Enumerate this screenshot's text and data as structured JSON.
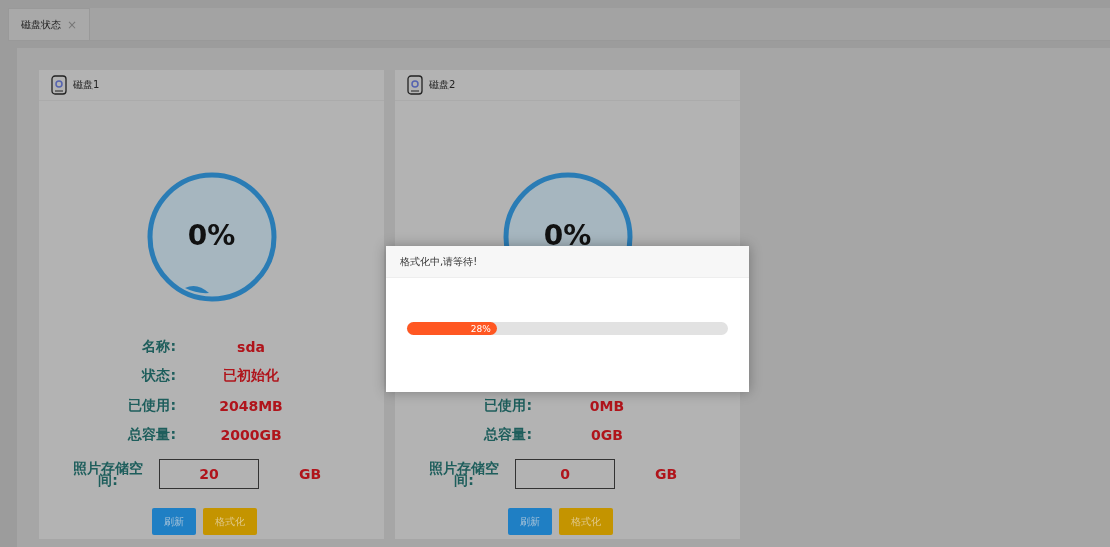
{
  "tabs": [
    {
      "label": "磁盘状态",
      "close": "×",
      "selected": true
    }
  ],
  "disks": [
    {
      "title": "磁盘1",
      "percent": "0%",
      "fields": [
        {
          "label": "名称:",
          "value": "sda"
        },
        {
          "label": "状态:",
          "value": "已初始化"
        },
        {
          "label": "已使用:",
          "value": "2048MB"
        },
        {
          "label": "总容量:",
          "value": "2000GB"
        }
      ],
      "storage": {
        "label": "照片存储空间:",
        "value": "20",
        "unit": "GB"
      },
      "buttons": [
        {
          "label": "刷新",
          "kind": "primary"
        },
        {
          "label": "格式化",
          "kind": "warning"
        }
      ]
    },
    {
      "title": "磁盘2",
      "percent": "0%",
      "fields": [
        {
          "label": "已使用:",
          "value": "0MB"
        },
        {
          "label": "总容量:",
          "value": "0GB"
        }
      ],
      "storage": {
        "label": "照片存储空间:",
        "value": "0",
        "unit": "GB"
      },
      "buttons": [
        {
          "label": "刷新",
          "kind": "primary"
        },
        {
          "label": "格式化",
          "kind": "warning"
        }
      ]
    }
  ],
  "dialog": {
    "title": "格式化中,请等待!",
    "progress": {
      "level": 0.28,
      "text": "28%"
    }
  }
}
